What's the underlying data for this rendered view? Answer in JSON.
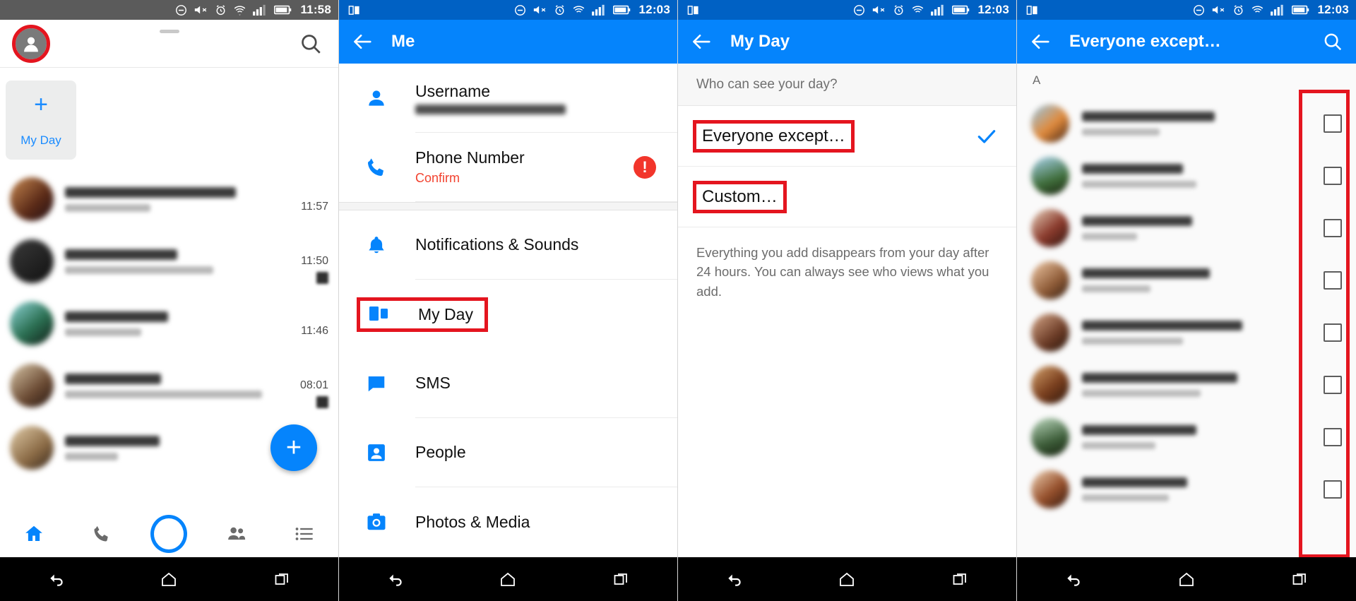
{
  "panels": {
    "chats": {
      "status": {
        "time": "11:58",
        "icons": [
          "dnd-icon",
          "mute-icon",
          "alarm-icon",
          "wifi-icon",
          "signal-icon",
          "battery-icon"
        ]
      },
      "avatar_icon": "profile-avatar-icon",
      "search_icon": "search-icon",
      "my_day": {
        "plus": "+",
        "label": "My Day"
      },
      "rows": [
        {
          "time": "11:57",
          "unread": false
        },
        {
          "time": "11:50",
          "unread": true
        },
        {
          "time": "11:46",
          "unread": false
        },
        {
          "time": "08:01",
          "unread": true
        },
        {
          "time": "",
          "unread": false
        }
      ],
      "fab_label": "+",
      "nav": [
        {
          "name": "home",
          "icon": "home-icon",
          "active": true
        },
        {
          "name": "calls",
          "icon": "phone-icon",
          "active": false
        },
        {
          "name": "camera",
          "icon": "camera-circle-icon",
          "active": false
        },
        {
          "name": "people",
          "icon": "people-icon",
          "active": false
        },
        {
          "name": "more",
          "icon": "list-icon",
          "active": false
        }
      ]
    },
    "me": {
      "status": {
        "time": "12:03",
        "icons": [
          "multiwindow-icon",
          "dnd-icon",
          "mute-icon",
          "alarm-icon",
          "wifi-icon",
          "signal-icon",
          "battery-icon"
        ]
      },
      "back_icon": "back-arrow-icon",
      "title": "Me",
      "items": [
        {
          "label": "Username",
          "icon": "person-icon",
          "sub_type": "blur",
          "sub": ""
        },
        {
          "label": "Phone Number",
          "icon": "phone-icon",
          "sub_type": "red",
          "sub": "Confirm",
          "warning": "!"
        },
        {
          "label": "Notifications & Sounds",
          "icon": "bell-icon",
          "sub_type": "none",
          "sub": ""
        },
        {
          "label": "My Day",
          "icon": "myday-icon",
          "sub_type": "none",
          "sub": "",
          "highlighted": true
        },
        {
          "label": "SMS",
          "icon": "sms-icon",
          "sub_type": "none",
          "sub": ""
        },
        {
          "label": "People",
          "icon": "contacts-icon",
          "sub_type": "none",
          "sub": ""
        },
        {
          "label": "Photos & Media",
          "icon": "photo-camera-icon",
          "sub_type": "none",
          "sub": ""
        }
      ]
    },
    "myday": {
      "status": {
        "time": "12:03",
        "icons": [
          "multiwindow-icon",
          "dnd-icon",
          "mute-icon",
          "alarm-icon",
          "wifi-icon",
          "signal-icon",
          "battery-icon"
        ]
      },
      "back_icon": "back-arrow-icon",
      "title": "My Day",
      "section_header": "Who can see your day?",
      "options": [
        {
          "label": "Everyone except…",
          "selected": true,
          "highlighted": true
        },
        {
          "label": "Custom…",
          "selected": false,
          "highlighted": true
        }
      ],
      "note": "Everything you add disappears from your day after 24 hours. You can always see who views what you add."
    },
    "picker": {
      "status": {
        "time": "12:03",
        "icons": [
          "multiwindow-icon",
          "dnd-icon",
          "mute-icon",
          "alarm-icon",
          "wifi-icon",
          "signal-icon",
          "battery-icon"
        ]
      },
      "back_icon": "back-arrow-icon",
      "title": "Everyone except…",
      "search_icon": "search-icon",
      "section_letter": "A",
      "contacts": [
        {
          "checked": false
        },
        {
          "checked": false
        },
        {
          "checked": false
        },
        {
          "checked": false
        },
        {
          "checked": false
        },
        {
          "checked": false
        },
        {
          "checked": false
        },
        {
          "checked": false
        }
      ]
    }
  },
  "android_nav": [
    {
      "name": "back",
      "icon": "android-back-icon"
    },
    {
      "name": "home",
      "icon": "android-home-icon"
    },
    {
      "name": "recents",
      "icon": "android-recents-icon"
    }
  ],
  "colors": {
    "primary": "#0584fc",
    "primary_dark": "#0061c4",
    "highlight": "#e4151f",
    "danger": "#f2352b",
    "status_dark": "#5b5b5b"
  }
}
